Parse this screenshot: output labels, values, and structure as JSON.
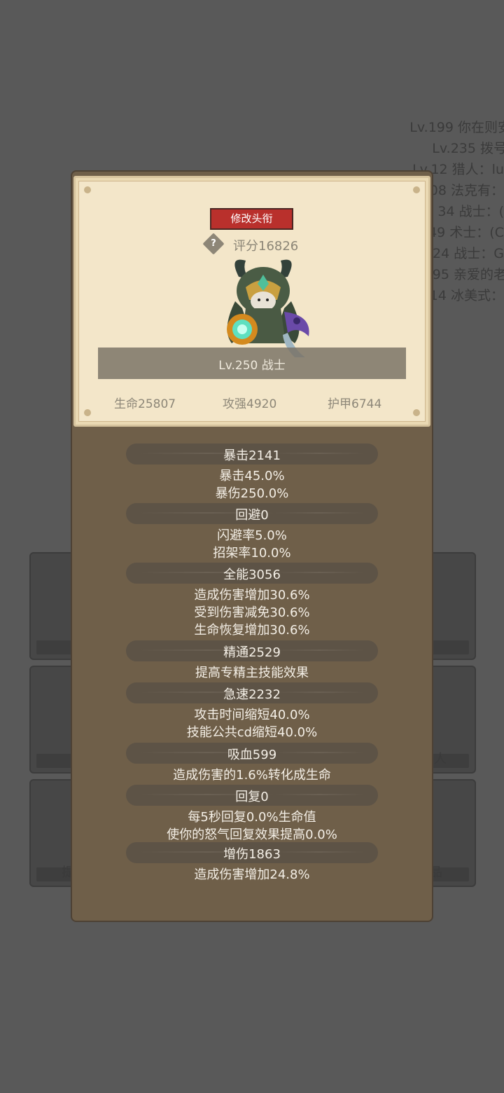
{
  "background": {
    "ranking": [
      "Lv.199 你在则安",
      "Lv.235 拨号",
      "Lv.12 猎人：lu",
      "108 法克有：",
      "34 战士：(",
      "49 术士：(C",
      "24 战士：G",
      "195 亲爱的老",
      "14 冰美式："
    ],
    "tile_labels": [
      "人",
      "提",
      "品"
    ]
  },
  "card": {
    "rename_label": "修改头衔",
    "help_glyph": "?",
    "score": "评分16826",
    "name": "Lv.250 战士",
    "stats": {
      "hp": "生命25807",
      "atk": "攻强4920",
      "armor": "护甲6744"
    }
  },
  "details": [
    {
      "header": "暴击2141",
      "lines": [
        "暴击45.0%",
        "暴伤250.0%"
      ]
    },
    {
      "header": "回避0",
      "lines": [
        "闪避率5.0%",
        "招架率10.0%"
      ]
    },
    {
      "header": "全能3056",
      "lines": [
        "造成伤害增加30.6%",
        "受到伤害减免30.6%",
        "生命恢复增加30.6%"
      ]
    },
    {
      "header": "精通2529",
      "lines": [
        "提高专精主技能效果"
      ]
    },
    {
      "header": "急速2232",
      "lines": [
        "攻击时间缩短40.0%",
        "技能公共cd缩短40.0%"
      ]
    },
    {
      "header": "吸血599",
      "lines": [
        "造成伤害的1.6%转化成生命"
      ]
    },
    {
      "header": "回复0",
      "lines": [
        "每5秒回复0.0%生命值",
        "使你的怒气回复效果提高0.0%"
      ]
    },
    {
      "header": "增伤1863",
      "lines": [
        "造成伤害增加24.8%"
      ]
    }
  ]
}
